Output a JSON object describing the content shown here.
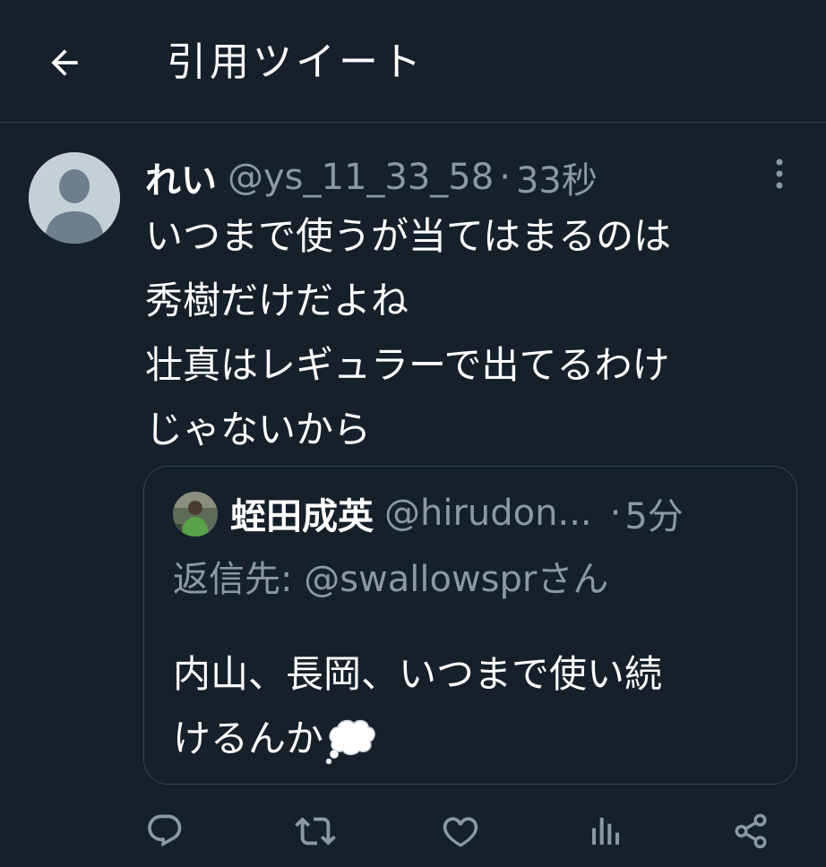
{
  "header": {
    "title": "引用ツイート",
    "back_icon": "arrow-left-icon"
  },
  "tweet": {
    "author_name": "れい",
    "author_handle": "@ys_11_33_58",
    "separator": "·",
    "time": "33秒",
    "text": "いつまで使うが当てはまるのは\n秀樹だけだよね\n壮真はレギュラーで出てるわけ\nじゃないから",
    "more_icon": "more-vertical-icon"
  },
  "quote": {
    "author_name": "蛭田成英",
    "author_handle": "@hirudon...",
    "separator": "·",
    "time": "5分",
    "reply_prefix": "返信先: ",
    "reply_handle": "@swallowspr",
    "reply_suffix": "さん",
    "text": "内山、長岡、いつまで使い続\nけるんか",
    "emoji_icon": "thought-balloon-icon"
  },
  "actions": {
    "reply_icon": "reply-icon",
    "retweet_icon": "retweet-icon",
    "like_icon": "like-icon",
    "analytics_icon": "analytics-icon",
    "share_icon": "share-icon"
  },
  "colors": {
    "background": "#15202b",
    "border": "#38444d",
    "secondary_text": "#8b98a5",
    "primary_text": "#ffffff",
    "icon": "#8b98a5"
  }
}
